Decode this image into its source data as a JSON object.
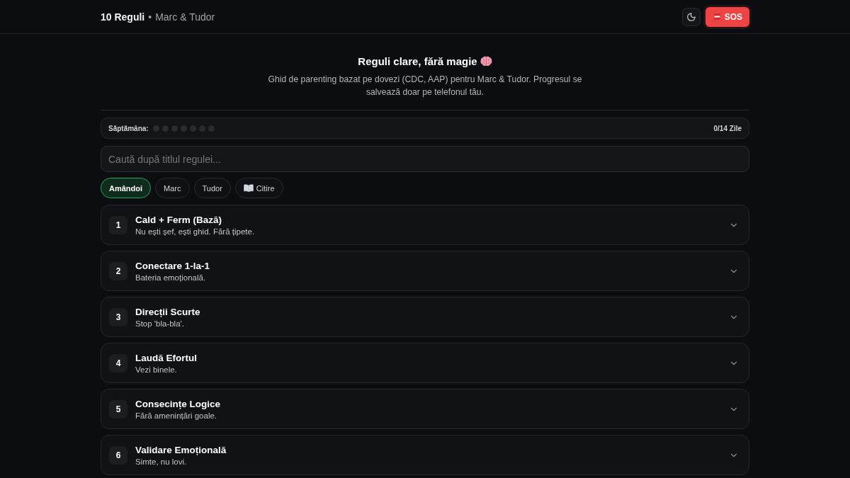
{
  "header": {
    "title": "10 Reguli",
    "separator": "•",
    "subtitle": "Marc & Tudor",
    "sos_button": {
      "label": "SOS"
    }
  },
  "hero": {
    "title": "Reguli clare, fără magie",
    "description": "Ghid de parenting bazat pe dovezi (CDC, AAP) pentru Marc & Tudor. Progresul se salvează doar pe telefonul tău."
  },
  "week_progress": {
    "label": "Săptămâna:",
    "days": [
      {
        "done": false
      },
      {
        "done": false
      },
      {
        "done": false
      },
      {
        "done": false
      },
      {
        "done": false
      },
      {
        "done": false
      },
      {
        "done": false
      }
    ],
    "count": "0/14 Zile"
  },
  "search": {
    "placeholder": "Caută după titlul regulei..."
  },
  "filters": [
    {
      "label": "Amândoi",
      "selected": true,
      "kind": "plain"
    },
    {
      "label": "Marc",
      "selected": false,
      "kind": "plain"
    },
    {
      "label": "Tudor",
      "selected": false,
      "kind": "plain"
    },
    {
      "label": "Citire",
      "selected": false,
      "kind": "reading"
    }
  ],
  "rules": [
    {
      "number": "1",
      "title": "Cald + Ferm (Bază)",
      "subtitle": "Nu ești șef, ești ghid. Fără țipete.",
      "expanded": false
    },
    {
      "number": "2",
      "title": "Conectare 1-la-1",
      "subtitle": "Bateria emoțională.",
      "expanded": false
    },
    {
      "number": "3",
      "title": "Direcții Scurte",
      "subtitle": "Stop 'bla-bla'.",
      "expanded": false
    },
    {
      "number": "4",
      "title": "Laudă Efortul",
      "subtitle": "Vezi binele.",
      "expanded": false
    },
    {
      "number": "5",
      "title": "Consecințe Logice",
      "subtitle": "Fără amenințări goale.",
      "expanded": false
    },
    {
      "number": "6",
      "title": "Validare Emoțională",
      "subtitle": "Simte, nu lovi.",
      "expanded": false
    }
  ]
}
